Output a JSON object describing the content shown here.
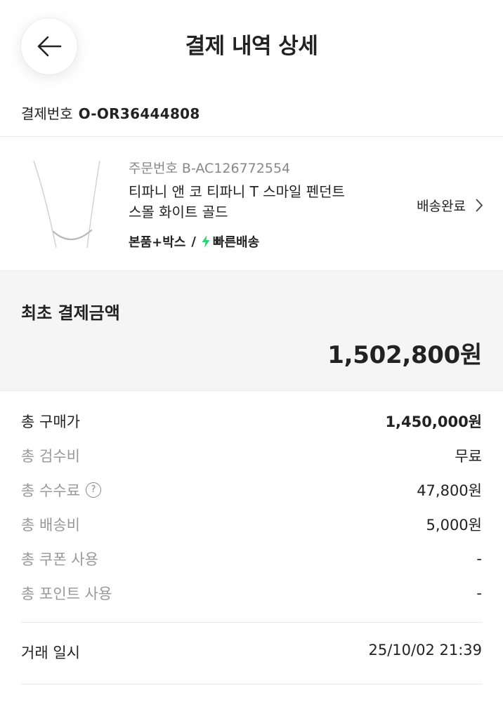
{
  "header": {
    "title": "결제 내역 상세"
  },
  "payment": {
    "label": "결제번호",
    "number": "O-OR36444808"
  },
  "product": {
    "order_label": "주문번호",
    "order_number": "B-AC126772554",
    "name_line1": "티파니 앤 코 티파니 T 스마일 펜던트",
    "name_line2": "스몰 화이트 골드",
    "option": "본품+박스",
    "separator": "/",
    "shipping": "빠른배송",
    "status": "배송완료",
    "bolt_color": "#2bd27b"
  },
  "initial_payment": {
    "label": "최초 결제금액",
    "amount": "1,502,800원"
  },
  "breakdown": [
    {
      "label": "총 구매가",
      "value": "1,450,000원"
    },
    {
      "label": "총 검수비",
      "value": "무료"
    },
    {
      "label": "총 수수료",
      "value": "47,800원",
      "help": "?"
    },
    {
      "label": "총 배송비",
      "value": "5,000원"
    },
    {
      "label": "총 쿠폰 사용",
      "value": "-"
    },
    {
      "label": "총 포인트 사용",
      "value": "-"
    }
  ],
  "transaction": {
    "label": "거래 일시",
    "value": "25/10/02 21:39"
  }
}
